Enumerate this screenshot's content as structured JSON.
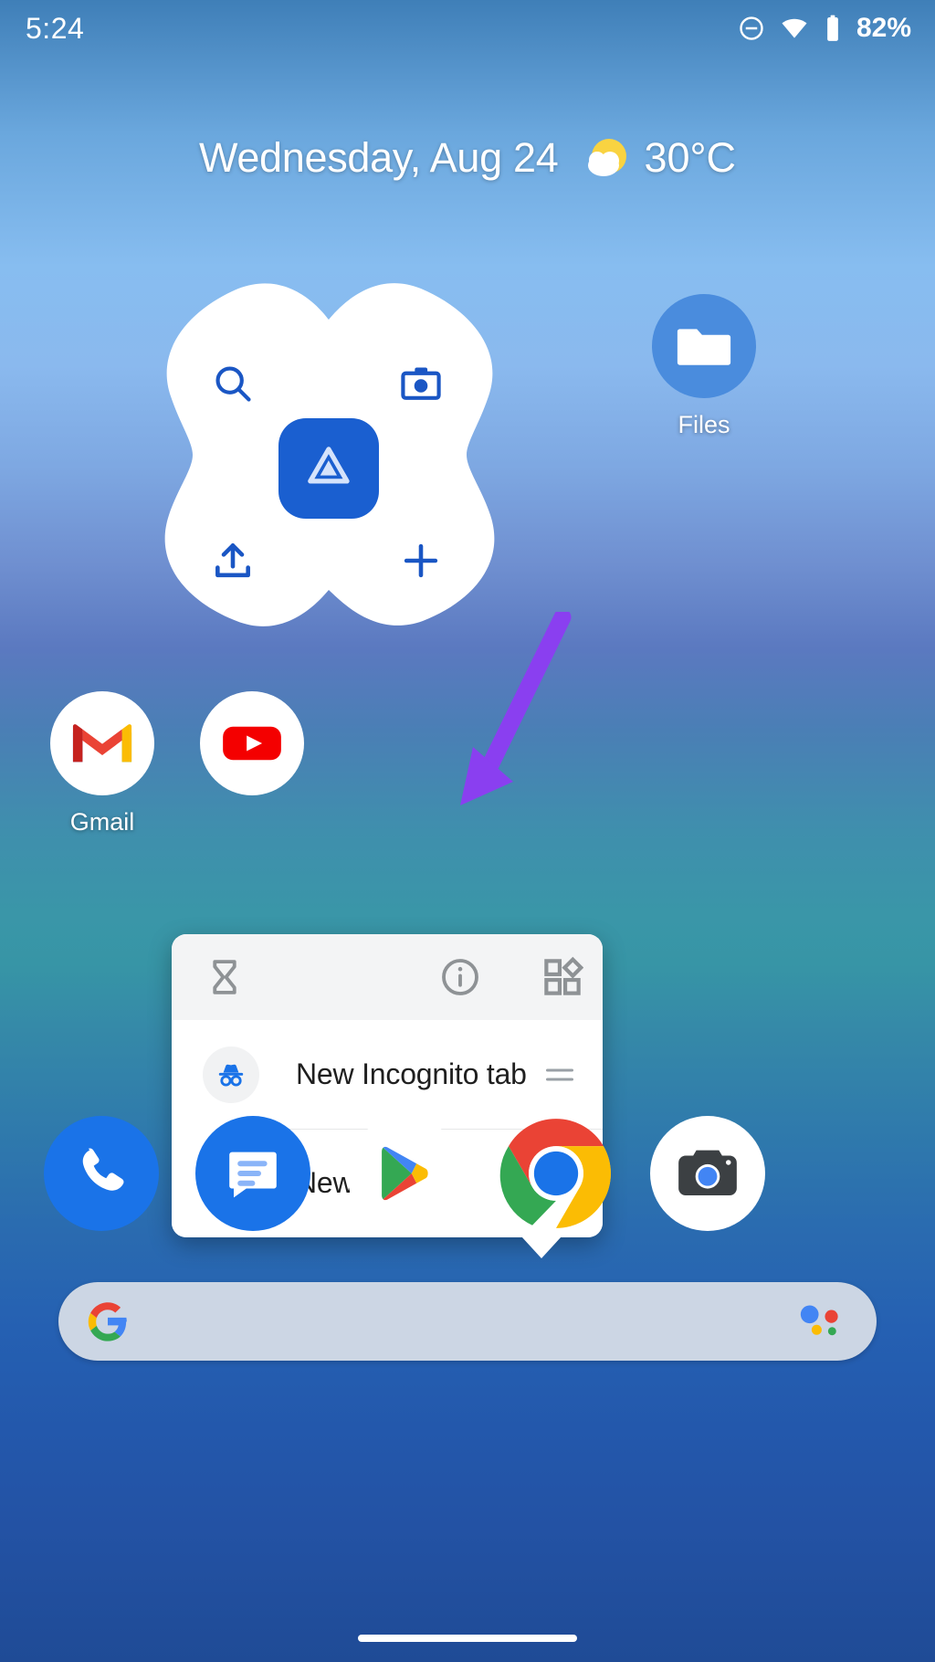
{
  "status_bar": {
    "time": "5:24",
    "battery_percent": "82%",
    "icons": [
      "do-not-disturb-icon",
      "wifi-icon",
      "battery-icon"
    ]
  },
  "date_widget": {
    "date": "Wednesday, Aug 24",
    "temperature": "30°C",
    "weather_icon": "partly-cloudy-icon"
  },
  "drive_widget": {
    "name": "Google Drive widget",
    "actions": [
      "search-icon",
      "camera-icon",
      "upload-icon",
      "plus-icon"
    ],
    "center_icon": "drive-icon"
  },
  "home_apps": [
    {
      "label": "Files",
      "icon": "folder-icon"
    },
    {
      "label": "Gmail",
      "icon": "gmail-icon"
    },
    {
      "label": "",
      "icon": "youtube-icon"
    }
  ],
  "popup": {
    "header_icons": [
      "hourglass-timer-icon",
      "app-info-icon",
      "widgets-icon"
    ],
    "items": [
      {
        "label": "New Incognito tab",
        "icon": "incognito-icon"
      },
      {
        "label": "New tab",
        "icon": "plus-icon"
      }
    ]
  },
  "dock": [
    {
      "label": "Phone",
      "icon": "phone-icon"
    },
    {
      "label": "Messages",
      "icon": "messages-icon"
    },
    {
      "label": "Play Store",
      "icon": "play-store-icon"
    },
    {
      "label": "Chrome",
      "icon": "chrome-icon"
    },
    {
      "label": "Camera",
      "icon": "camera-icon"
    }
  ],
  "search_bar": {
    "left_icon": "google-g-icon",
    "right_icon": "assistant-icon",
    "value": "",
    "placeholder": ""
  },
  "annotation": {
    "type": "arrow",
    "color": "#8a3ff0"
  },
  "colors": {
    "accent_blue": "#1a73e8",
    "popup_bg": "#ffffff",
    "popup_header_bg": "#f3f4f5",
    "wallpaper_top": "#87bdf0",
    "wallpaper_bottom": "#1f4b96"
  },
  "nav": {
    "pill": "gesture-nav-pill"
  }
}
